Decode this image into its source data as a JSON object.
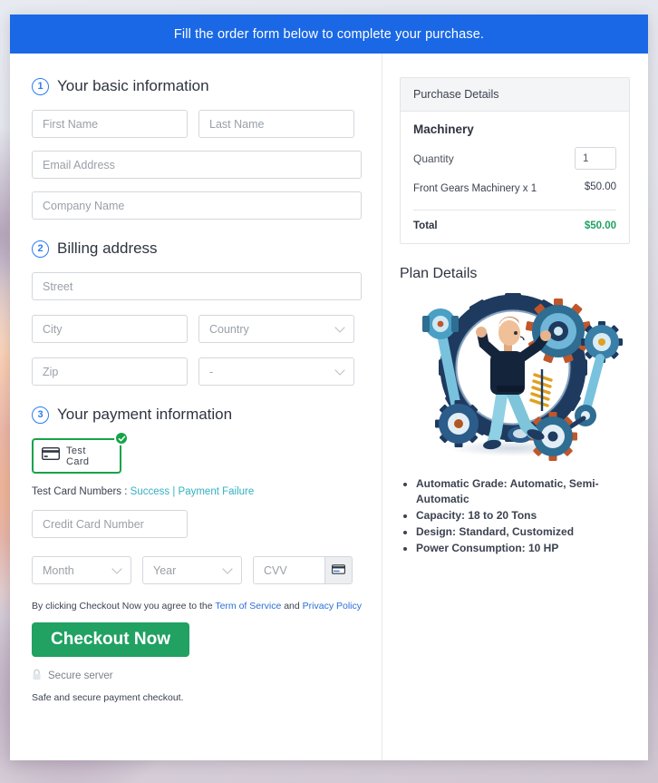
{
  "banner": {
    "text": "Fill the order form below to complete your purchase."
  },
  "sections": {
    "basic": {
      "number": "1",
      "title": "Your basic information",
      "fields": {
        "first_name": "First Name",
        "last_name": "Last Name",
        "email": "Email Address",
        "company": "Company Name"
      }
    },
    "billing": {
      "number": "2",
      "title": "Billing address",
      "fields": {
        "street": "Street",
        "city": "City",
        "country": "Country",
        "zip": "Zip",
        "state": "-"
      }
    },
    "payment": {
      "number": "3",
      "title": "Your payment information",
      "tile_label": "Test Card",
      "test_numbers_label": "Test Card Numbers :",
      "success_link": "Success",
      "separator": "|",
      "failure_link": "Payment Failure",
      "card_number": "Credit Card Number",
      "month": "Month",
      "year": "Year",
      "cvv": "CVV"
    }
  },
  "footer": {
    "terms_prefix": "By clicking Checkout Now you agree to the",
    "terms_link": "Term of Service",
    "terms_and": "and",
    "privacy_link": "Privacy Policy",
    "checkout_label": "Checkout Now",
    "secure_server": "Secure server",
    "safe_note": "Safe and secure payment checkout."
  },
  "purchase": {
    "panel_title": "Purchase Details",
    "product": "Machinery",
    "quantity_label": "Quantity",
    "quantity_value": "1",
    "line_item": "Front Gears Machinery x 1",
    "line_amount": "$50.00",
    "total_label": "Total",
    "total_amount": "$50.00"
  },
  "plan": {
    "title": "Plan Details",
    "bullets": [
      "Automatic Grade: Automatic, Semi-Automatic",
      "Capacity: 18 to 20 Tons",
      "Design: Standard, Customized",
      "Power Consumption: 10 HP"
    ]
  },
  "colors": {
    "banner_blue": "#1a68e5",
    "accent_blue": "#2b7cf0",
    "success_green": "#21a162",
    "tile_green": "#16a34a",
    "link_teal": "#33b0c4",
    "link_blue": "#2b6fd6"
  }
}
